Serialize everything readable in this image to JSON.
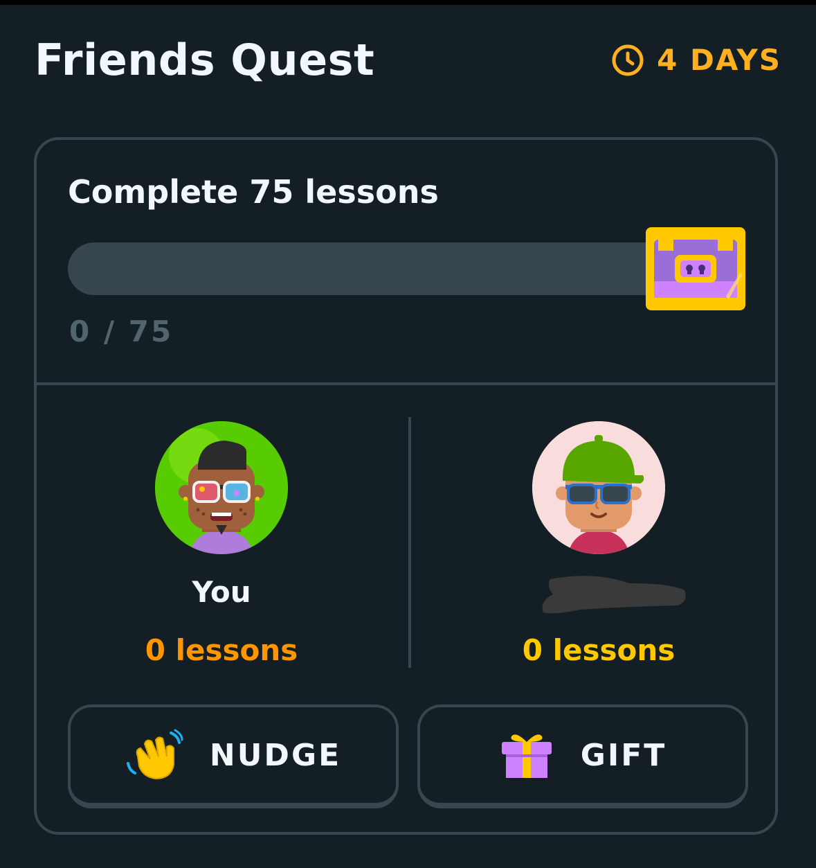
{
  "header": {
    "title": "Friends Quest",
    "timer_label": "4 DAYS",
    "timer_icon": "clock-icon"
  },
  "quest": {
    "goal_label": "Complete 75 lessons",
    "progress_text": "0 / 75",
    "progress_fraction": 0,
    "reward_icon": "treasure-chest-icon"
  },
  "participants": [
    {
      "name": "You",
      "lessons_label": "0 lessons",
      "color": "#ff9600"
    },
    {
      "name": "",
      "lessons_label": "0 lessons",
      "color": "#ffc800"
    }
  ],
  "actions": {
    "nudge_label": "NUDGE",
    "gift_label": "GIFT"
  },
  "colors": {
    "background": "#131f24",
    "border": "#37464f",
    "accent_timer": "#ffb020"
  }
}
